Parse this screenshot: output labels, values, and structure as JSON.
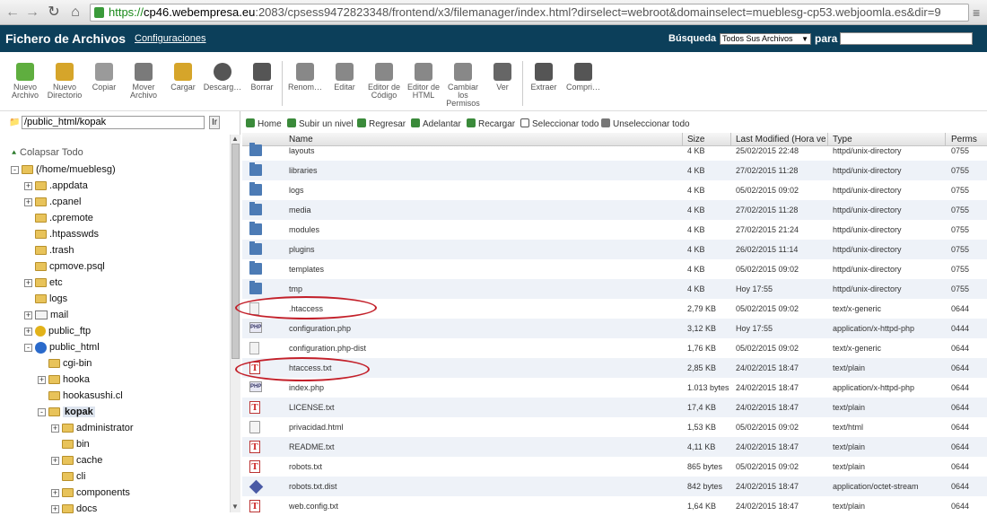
{
  "browser": {
    "url_https": "https://",
    "url_host": "cp46.webempresa.eu",
    "url_rest": ":2083/cpsess9472823348/frontend/x3/filemanager/index.html?dirselect=webroot&domainselect=mueblesg-cp53.webjoomla.es&dir=9"
  },
  "header": {
    "title": "Fichero de Archivos",
    "config_link": "Configuraciones",
    "search_label": "Búsqueda",
    "search_scope": "Todos Sus Archivos",
    "para_label": "para",
    "search_value": ""
  },
  "toolbar": [
    {
      "icon": "new-file-icon",
      "label1": "Nuevo",
      "label2": "Archivo",
      "label3": ""
    },
    {
      "icon": "new-folder-icon",
      "label1": "Nuevo",
      "label2": "Directorio",
      "label3": ""
    },
    {
      "icon": "copy-icon",
      "label1": "Copiar",
      "label2": "",
      "label3": ""
    },
    {
      "icon": "move-icon",
      "label1": "Mover",
      "label2": "Archivo",
      "label3": ""
    },
    {
      "icon": "upload-icon",
      "label1": "Cargar",
      "label2": "",
      "label3": ""
    },
    {
      "icon": "download-icon",
      "label1": "Descarg…",
      "label2": "",
      "label3": ""
    },
    {
      "icon": "delete-icon",
      "label1": "Borrar",
      "label2": "",
      "label3": ""
    },
    {
      "icon": "rename-icon",
      "label1": "Renom…",
      "label2": "",
      "label3": ""
    },
    {
      "icon": "edit-icon",
      "label1": "Editar",
      "label2": "",
      "label3": ""
    },
    {
      "icon": "code-editor-icon",
      "label1": "Editor de",
      "label2": "Código",
      "label3": ""
    },
    {
      "icon": "html-editor-icon",
      "label1": "Editor de",
      "label2": "HTML",
      "label3": ""
    },
    {
      "icon": "permissions-icon",
      "label1": "Cambiar",
      "label2": "los",
      "label3": "Permisos"
    },
    {
      "icon": "view-icon",
      "label1": "Ver",
      "label2": "",
      "label3": ""
    },
    {
      "icon": "extract-icon",
      "label1": "Extraer",
      "label2": "",
      "label3": ""
    },
    {
      "icon": "compress-icon",
      "label1": "Compri…",
      "label2": "",
      "label3": ""
    }
  ],
  "path": {
    "value": "/public_html/kopak",
    "go": "Ir"
  },
  "tree": {
    "collapse_all": "Colapsar Todo",
    "nodes": [
      {
        "label": "(/home/mueblesg)",
        "kind": "folder",
        "level": 0,
        "exp": "⊟"
      },
      {
        "label": ".appdata",
        "kind": "folder",
        "level": 1,
        "exp": "+"
      },
      {
        "label": ".cpanel",
        "kind": "folder",
        "level": 1,
        "exp": "+"
      },
      {
        "label": ".cpremote",
        "kind": "folder",
        "level": 1,
        "exp": ""
      },
      {
        "label": ".htpasswds",
        "kind": "folder",
        "level": 1,
        "exp": ""
      },
      {
        "label": ".trash",
        "kind": "folder",
        "level": 1,
        "exp": ""
      },
      {
        "label": "cpmove.psql",
        "kind": "folder",
        "level": 1,
        "exp": ""
      },
      {
        "label": "etc",
        "kind": "folder",
        "level": 1,
        "exp": "+"
      },
      {
        "label": "logs",
        "kind": "folder",
        "level": 1,
        "exp": ""
      },
      {
        "label": "mail",
        "kind": "mail",
        "level": 1,
        "exp": "+"
      },
      {
        "label": "public_ftp",
        "kind": "ftp",
        "level": 1,
        "exp": "+"
      },
      {
        "label": "public_html",
        "kind": "globe",
        "level": 1,
        "exp": "-"
      },
      {
        "label": "cgi-bin",
        "kind": "folder",
        "level": 2,
        "exp": ""
      },
      {
        "label": "hooka",
        "kind": "folder",
        "level": 2,
        "exp": "+"
      },
      {
        "label": "hookasushi.cl",
        "kind": "folder",
        "level": 2,
        "exp": ""
      },
      {
        "label": "kopak",
        "kind": "folder",
        "level": 2,
        "exp": "-",
        "selected": true
      },
      {
        "label": "administrator",
        "kind": "folder",
        "level": 3,
        "exp": "+"
      },
      {
        "label": "bin",
        "kind": "folder",
        "level": 3,
        "exp": ""
      },
      {
        "label": "cache",
        "kind": "folder",
        "level": 3,
        "exp": "+"
      },
      {
        "label": "cli",
        "kind": "folder",
        "level": 3,
        "exp": ""
      },
      {
        "label": "components",
        "kind": "folder",
        "level": 3,
        "exp": "+"
      },
      {
        "label": "docs",
        "kind": "folder",
        "level": 3,
        "exp": "+"
      }
    ]
  },
  "actions": [
    {
      "icon": "home-icon",
      "label": "Home"
    },
    {
      "icon": "up-level-icon",
      "label": "Subir un nivel"
    },
    {
      "icon": "back-icon",
      "label": "Regresar"
    },
    {
      "icon": "forward-icon",
      "label": "Adelantar"
    },
    {
      "icon": "reload-icon",
      "label": "Recargar"
    },
    {
      "icon": "select-all-icon",
      "label": "Seleccionar todo"
    },
    {
      "icon": "unselect-all-icon",
      "label": "Unseleccionar todo"
    }
  ],
  "columns": {
    "name": "Name",
    "size": "Size",
    "modified": "Last Modified (Hora vera",
    "type": "Type",
    "perms": "Perms"
  },
  "files": [
    {
      "icon": "folder",
      "name": "layouts",
      "size": "4 KB",
      "modified": "25/02/2015 22:48",
      "type": "httpd/unix-directory",
      "perms": "0755"
    },
    {
      "icon": "folder",
      "name": "libraries",
      "size": "4 KB",
      "modified": "27/02/2015 11:28",
      "type": "httpd/unix-directory",
      "perms": "0755"
    },
    {
      "icon": "folder",
      "name": "logs",
      "size": "4 KB",
      "modified": "05/02/2015 09:02",
      "type": "httpd/unix-directory",
      "perms": "0755"
    },
    {
      "icon": "folder",
      "name": "media",
      "size": "4 KB",
      "modified": "27/02/2015 11:28",
      "type": "httpd/unix-directory",
      "perms": "0755"
    },
    {
      "icon": "folder",
      "name": "modules",
      "size": "4 KB",
      "modified": "27/02/2015 21:24",
      "type": "httpd/unix-directory",
      "perms": "0755"
    },
    {
      "icon": "folder",
      "name": "plugins",
      "size": "4 KB",
      "modified": "26/02/2015 11:14",
      "type": "httpd/unix-directory",
      "perms": "0755"
    },
    {
      "icon": "folder",
      "name": "templates",
      "size": "4 KB",
      "modified": "05/02/2015 09:02",
      "type": "httpd/unix-directory",
      "perms": "0755"
    },
    {
      "icon": "folder",
      "name": "tmp",
      "size": "4 KB",
      "modified": "Hoy 17:55",
      "type": "httpd/unix-directory",
      "perms": "0755"
    },
    {
      "icon": "generic",
      "name": ".htaccess",
      "size": "2,79 KB",
      "modified": "05/02/2015 09:02",
      "type": "text/x-generic",
      "perms": "0644"
    },
    {
      "icon": "php",
      "name": "configuration.php",
      "size": "3,12 KB",
      "modified": "Hoy 17:55",
      "type": "application/x-httpd-php",
      "perms": "0444"
    },
    {
      "icon": "generic",
      "name": "configuration.php-dist",
      "size": "1,76 KB",
      "modified": "05/02/2015 09:02",
      "type": "text/x-generic",
      "perms": "0644"
    },
    {
      "icon": "txt",
      "name": "htaccess.txt",
      "size": "2,85 KB",
      "modified": "24/02/2015 18:47",
      "type": "text/plain",
      "perms": "0644"
    },
    {
      "icon": "php",
      "name": "index.php",
      "size": "1.013 bytes",
      "modified": "24/02/2015 18:47",
      "type": "application/x-httpd-php",
      "perms": "0644"
    },
    {
      "icon": "txt",
      "name": "LICENSE.txt",
      "size": "17,4 KB",
      "modified": "24/02/2015 18:47",
      "type": "text/plain",
      "perms": "0644"
    },
    {
      "icon": "html",
      "name": "privacidad.html",
      "size": "1,53 KB",
      "modified": "05/02/2015 09:02",
      "type": "text/html",
      "perms": "0644"
    },
    {
      "icon": "txt",
      "name": "README.txt",
      "size": "4,11 KB",
      "modified": "24/02/2015 18:47",
      "type": "text/plain",
      "perms": "0644"
    },
    {
      "icon": "txt",
      "name": "robots.txt",
      "size": "865 bytes",
      "modified": "05/02/2015 09:02",
      "type": "text/plain",
      "perms": "0644"
    },
    {
      "icon": "dist",
      "name": "robots.txt.dist",
      "size": "842 bytes",
      "modified": "24/02/2015 18:47",
      "type": "application/octet-stream",
      "perms": "0644"
    },
    {
      "icon": "txt",
      "name": "web.config.txt",
      "size": "1,64 KB",
      "modified": "24/02/2015 18:47",
      "type": "text/plain",
      "perms": "0644"
    }
  ],
  "colors": {
    "header_bg": "#0c3f5a",
    "row_alt": "#eef2f8",
    "annotation_red": "#c3202a",
    "folder_blue": "#4c7bb5"
  }
}
